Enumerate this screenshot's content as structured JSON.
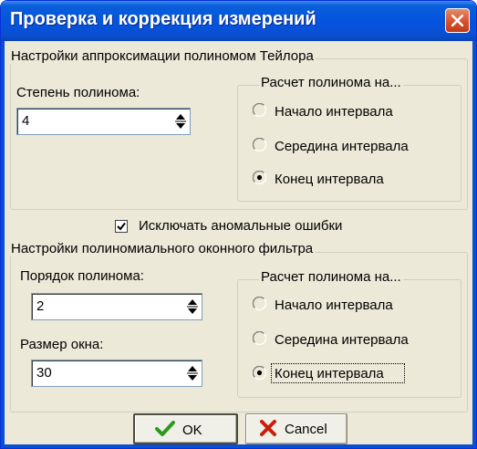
{
  "window": {
    "title": "Проверка и коррекция измерений"
  },
  "taylor_group": {
    "title": "Настройки аппроксимации полиномом Тейлора",
    "degree_label": "Степень полинома:",
    "degree_value": "4",
    "calc_group": {
      "title": "Расчет полинома на...",
      "options": [
        "Начало интервала",
        "Середина интервала",
        "Конец интервала"
      ],
      "selected": 2
    }
  },
  "anomaly_checkbox": {
    "label": "Исключать аномальные ошибки",
    "checked": true
  },
  "filter_group": {
    "title": "Настройки полиномиального оконного фильтра",
    "order_label": "Порядок полинома:",
    "order_value": "2",
    "window_label": "Размер окна:",
    "window_value": "30",
    "calc_group": {
      "title": "Расчет полинома на...",
      "options": [
        "Начало интервала",
        "Середина интервала",
        "Конец интервала"
      ],
      "selected": 2
    }
  },
  "buttons": {
    "ok": "OK",
    "cancel": "Cancel"
  },
  "icons": {
    "close": "close-icon",
    "ok": "checkmark-icon",
    "cancel": "cross-icon",
    "spin": "spin-arrows-icon"
  },
  "colors": {
    "titlebar": "#0454e0",
    "close_button": "#d6532b",
    "dialog_bg": "#ece9d8",
    "ok_icon": "#2a9a1a",
    "cancel_icon": "#c81e0a"
  }
}
